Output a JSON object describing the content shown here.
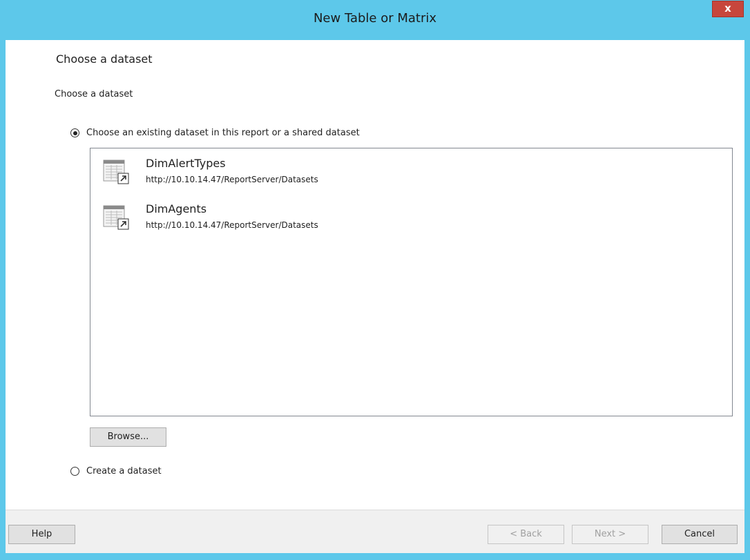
{
  "window": {
    "title": "New Table or Matrix",
    "close_label": "x"
  },
  "page": {
    "title": "Choose a dataset",
    "section_label": "Choose a dataset"
  },
  "options": {
    "existing_label": "Choose an existing dataset in this report or a shared dataset",
    "existing_selected": true,
    "create_label": "Create a dataset",
    "create_selected": false
  },
  "datasets": [
    {
      "name": "DimAlertTypes",
      "path": "http://10.10.14.47/ReportServer/Datasets",
      "icon": "shared-dataset-icon"
    },
    {
      "name": "DimAgents",
      "path": "http://10.10.14.47/ReportServer/Datasets",
      "icon": "shared-dataset-icon"
    }
  ],
  "buttons": {
    "browse": "Browse...",
    "help": "Help",
    "back": "< Back",
    "next": "Next >",
    "cancel": "Cancel"
  },
  "colors": {
    "titlebar": "#5dc8ea",
    "close": "#c7463c"
  }
}
